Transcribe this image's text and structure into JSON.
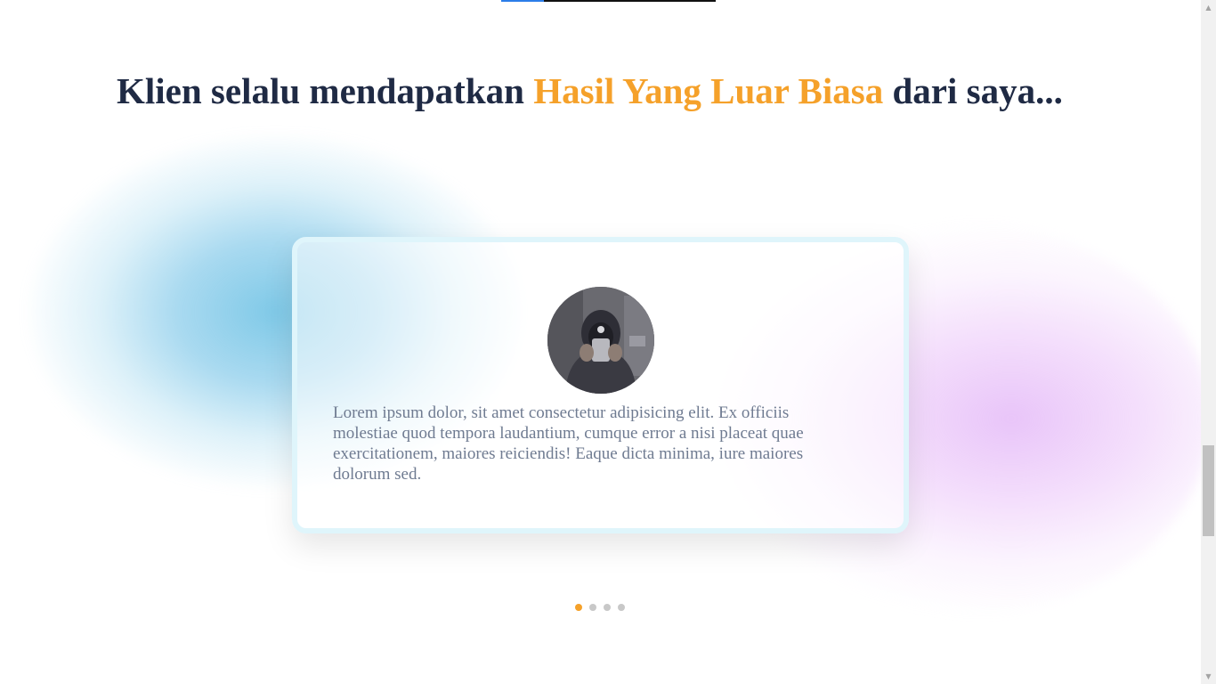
{
  "heading": {
    "part1": "Klien selalu mendapatkan ",
    "highlight": "Hasil Yang Luar Biasa",
    "part2": " dari saya..."
  },
  "testimonial": {
    "text": "Lorem ipsum dolor, sit amet consectetur adipisicing elit. Ex officiis molestiae quod tempora laudantium, cumque error a nisi placeat quae exercitationem, maiores reiciendis! Eaque dicta minima, iure maiores dolorum sed."
  },
  "carousel": {
    "total_slides": 4,
    "active_index": 0
  },
  "colors": {
    "heading": "#1f2a44",
    "accent": "#f5a12a",
    "body_text": "#6f7b91",
    "dot_inactive": "#c8c8c8",
    "card_border": "#dff5fb",
    "blob_blue": "#8ccde6",
    "blob_purple": "#eac6f8"
  },
  "icons": {
    "scroll_up": "▲",
    "scroll_down": "▼"
  }
}
